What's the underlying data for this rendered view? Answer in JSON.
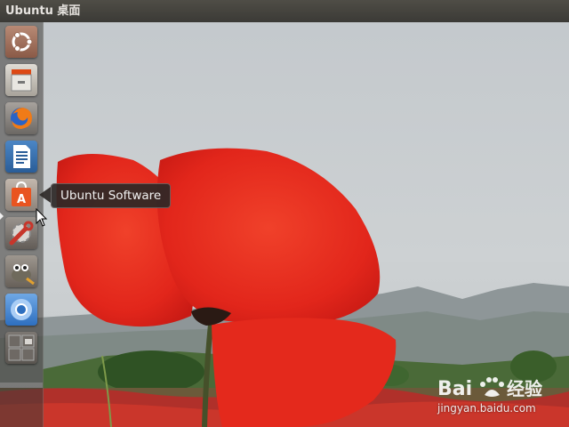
{
  "top_panel": {
    "title": "Ubuntu 桌面"
  },
  "launcher": {
    "items": [
      {
        "name": "dash-home",
        "icon": "ubuntu-logo-icon"
      },
      {
        "name": "files",
        "icon": "file-cabinet-icon"
      },
      {
        "name": "firefox",
        "icon": "firefox-icon"
      },
      {
        "name": "libreoffice-writer",
        "icon": "document-icon"
      },
      {
        "name": "ubuntu-software",
        "icon": "shopping-bag-icon"
      },
      {
        "name": "system-settings",
        "icon": "wrench-gear-icon"
      },
      {
        "name": "gimp",
        "icon": "gimp-icon"
      },
      {
        "name": "chromium",
        "icon": "chromium-icon"
      },
      {
        "name": "workspace-switcher",
        "icon": "workspace-icon"
      }
    ]
  },
  "tooltip": {
    "label": "Ubuntu Software"
  },
  "watermark": {
    "logo_text": "Bai 经验",
    "url": "jingyan.baidu.com"
  },
  "colors": {
    "panel": "#3c3b37",
    "launcher": "#3e3a36",
    "accent_orange": "#dd4814",
    "poppy_red": "#e8281e"
  }
}
